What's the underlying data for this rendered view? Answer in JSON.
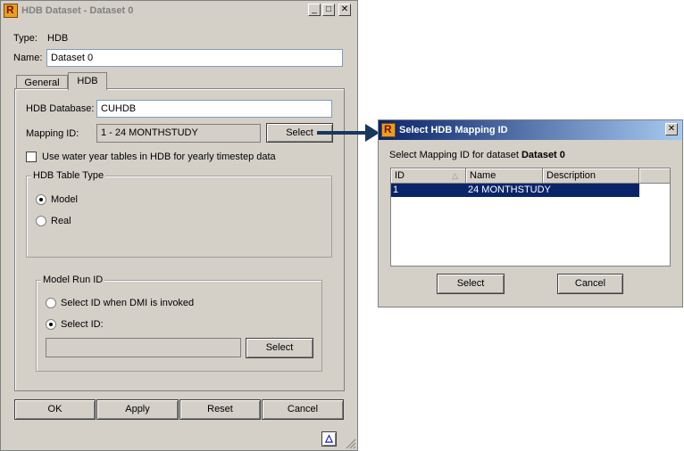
{
  "main_dialog": {
    "title": "HDB Dataset - Dataset 0",
    "type_label": "Type:",
    "type_value": "HDB",
    "name_label": "Name:",
    "name_value": "Dataset 0",
    "tabs": [
      {
        "label": "General"
      },
      {
        "label": "HDB"
      }
    ],
    "hdb_database_label": "HDB Database:",
    "hdb_database_value": "CUHDB",
    "mapping_id_label": "Mapping ID:",
    "mapping_id_value": "1 - 24 MONTHSTUDY",
    "select_label": "Select",
    "water_year_label": "Use water year tables in HDB for yearly timestep data",
    "table_type_group": "HDB Table Type",
    "table_type_options": [
      {
        "label": "Model",
        "selected": true
      },
      {
        "label": "Real",
        "selected": false
      }
    ],
    "model_run_group": "Model Run ID",
    "model_run_options": [
      {
        "label": "Select ID when DMI is invoked",
        "selected": false
      },
      {
        "label": "Select ID:",
        "selected": true
      }
    ],
    "select_id_value": "",
    "select_id_button": "Select",
    "buttons": {
      "ok": "OK",
      "apply": "Apply",
      "reset": "Reset",
      "cancel": "Cancel"
    },
    "delta_icon": "△"
  },
  "mapping_dialog": {
    "title": "Select HDB Mapping ID",
    "prompt_prefix": "Select Mapping ID for dataset",
    "prompt_dataset": "Dataset 0",
    "columns": [
      {
        "label": "ID"
      },
      {
        "label": "Name"
      },
      {
        "label": "Description"
      }
    ],
    "rows": [
      {
        "id": "1",
        "name": "24 MONTHSTUDY",
        "description": ""
      }
    ],
    "select_button": "Select",
    "cancel_button": "Cancel"
  },
  "colors": {
    "titlebar_active": "#0a246a",
    "selection": "#0a246a",
    "face": "#d4d0c8"
  }
}
